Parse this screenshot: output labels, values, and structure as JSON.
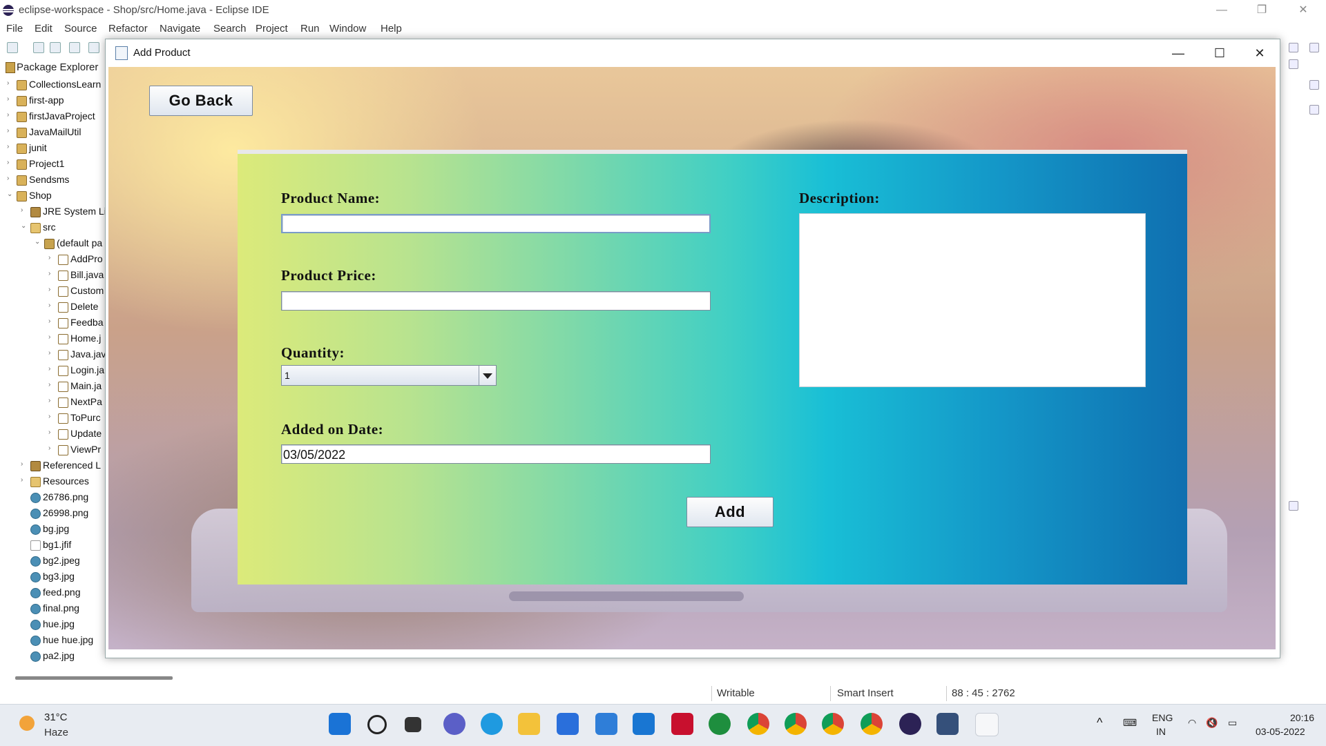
{
  "eclipse": {
    "title": "eclipse-workspace - Shop/src/Home.java - Eclipse IDE",
    "menu": [
      "File",
      "Edit",
      "Source",
      "Refactor",
      "Navigate",
      "Search",
      "Project",
      "Run",
      "Window",
      "Help"
    ],
    "package_explorer_label": "Package Explorer",
    "tree": [
      {
        "label": "CollectionsLearn",
        "indent": 0,
        "icon": "project",
        "twisty": "›"
      },
      {
        "label": "first-app",
        "indent": 0,
        "icon": "project",
        "twisty": "›"
      },
      {
        "label": "firstJavaProject",
        "indent": 0,
        "icon": "project",
        "twisty": "›"
      },
      {
        "label": "JavaMailUtil",
        "indent": 0,
        "icon": "project",
        "twisty": "›"
      },
      {
        "label": "junit",
        "indent": 0,
        "icon": "project",
        "twisty": "›"
      },
      {
        "label": "Project1",
        "indent": 0,
        "icon": "project",
        "twisty": "›"
      },
      {
        "label": "Sendsms",
        "indent": 0,
        "icon": "project",
        "twisty": "›"
      },
      {
        "label": "Shop",
        "indent": 0,
        "icon": "project",
        "twisty": "⌄"
      },
      {
        "label": "JRE System Li",
        "indent": 1,
        "icon": "lib",
        "twisty": "›"
      },
      {
        "label": "src",
        "indent": 1,
        "icon": "folder",
        "twisty": "⌄"
      },
      {
        "label": "(default pa",
        "indent": 2,
        "icon": "pkg",
        "twisty": "⌄"
      },
      {
        "label": "AddPro",
        "indent": 3,
        "icon": "java",
        "twisty": "›"
      },
      {
        "label": "Bill.java",
        "indent": 3,
        "icon": "java",
        "twisty": "›"
      },
      {
        "label": "Custom",
        "indent": 3,
        "icon": "java",
        "twisty": "›"
      },
      {
        "label": "Delete",
        "indent": 3,
        "icon": "java",
        "twisty": "›"
      },
      {
        "label": "Feedba",
        "indent": 3,
        "icon": "java",
        "twisty": "›"
      },
      {
        "label": "Home.j",
        "indent": 3,
        "icon": "java",
        "twisty": "›"
      },
      {
        "label": "Java.jav",
        "indent": 3,
        "icon": "java",
        "twisty": "›"
      },
      {
        "label": "Login.ja",
        "indent": 3,
        "icon": "java",
        "twisty": "›"
      },
      {
        "label": "Main.ja",
        "indent": 3,
        "icon": "java",
        "twisty": "›"
      },
      {
        "label": "NextPa",
        "indent": 3,
        "icon": "java",
        "twisty": "›"
      },
      {
        "label": "ToPurc",
        "indent": 3,
        "icon": "java",
        "twisty": "›"
      },
      {
        "label": "Update",
        "indent": 3,
        "icon": "java",
        "twisty": "›"
      },
      {
        "label": "ViewPr",
        "indent": 3,
        "icon": "java",
        "twisty": "›"
      },
      {
        "label": "Referenced L",
        "indent": 1,
        "icon": "lib",
        "twisty": "›"
      },
      {
        "label": "Resources",
        "indent": 1,
        "icon": "folder",
        "twisty": "›"
      },
      {
        "label": "26786.png",
        "indent": 1,
        "icon": "img",
        "twisty": ""
      },
      {
        "label": "26998.png",
        "indent": 1,
        "icon": "img",
        "twisty": ""
      },
      {
        "label": "bg.jpg",
        "indent": 1,
        "icon": "img",
        "twisty": ""
      },
      {
        "label": "bg1.jfif",
        "indent": 1,
        "icon": "file",
        "twisty": ""
      },
      {
        "label": "bg2.jpeg",
        "indent": 1,
        "icon": "img",
        "twisty": ""
      },
      {
        "label": "bg3.jpg",
        "indent": 1,
        "icon": "img",
        "twisty": ""
      },
      {
        "label": "feed.png",
        "indent": 1,
        "icon": "img",
        "twisty": ""
      },
      {
        "label": "final.png",
        "indent": 1,
        "icon": "img",
        "twisty": ""
      },
      {
        "label": "hue.jpg",
        "indent": 1,
        "icon": "img",
        "twisty": ""
      },
      {
        "label": "hue hue.jpg",
        "indent": 1,
        "icon": "img",
        "twisty": ""
      },
      {
        "label": "pa2.jpg",
        "indent": 1,
        "icon": "img",
        "twisty": ""
      }
    ],
    "status": {
      "writable": "Writable",
      "insert_mode": "Smart Insert",
      "position": "88 : 45 : 2762"
    }
  },
  "dialog": {
    "title": "Add Product",
    "go_back_label": "Go Back",
    "product_name_label": "Product Name:",
    "product_name_value": "",
    "product_price_label": "Product Price:",
    "product_price_value": "",
    "quantity_label": "Quantity:",
    "quantity_value": "1",
    "added_on_date_label": "Added on Date:",
    "added_on_date_value": "03/05/2022",
    "description_label": "Description:",
    "description_value": "",
    "add_label": "Add",
    "panel_gradient": [
      "#dcea7a",
      "#7fd9a9",
      "#19bfd6",
      "#0f6fb0"
    ]
  },
  "taskbar": {
    "weather_temp": "31°C",
    "weather_desc": "Haze",
    "apps": [
      "windows-start-icon",
      "search-icon",
      "task-view-icon",
      "chat-icon",
      "edge-icon",
      "file-explorer-icon",
      "store-icon",
      "mail-icon",
      "l-app-icon",
      "mcafee-icon",
      "xbox-icon",
      "chrome-icon",
      "chrome-icon",
      "chrome-icon",
      "chrome-icon",
      "eclipse-icon",
      "snipping-icon",
      "java-icon"
    ],
    "language_top": "ENG",
    "language_bottom": "IN",
    "time": "20:16",
    "date": "03-05-2022"
  }
}
